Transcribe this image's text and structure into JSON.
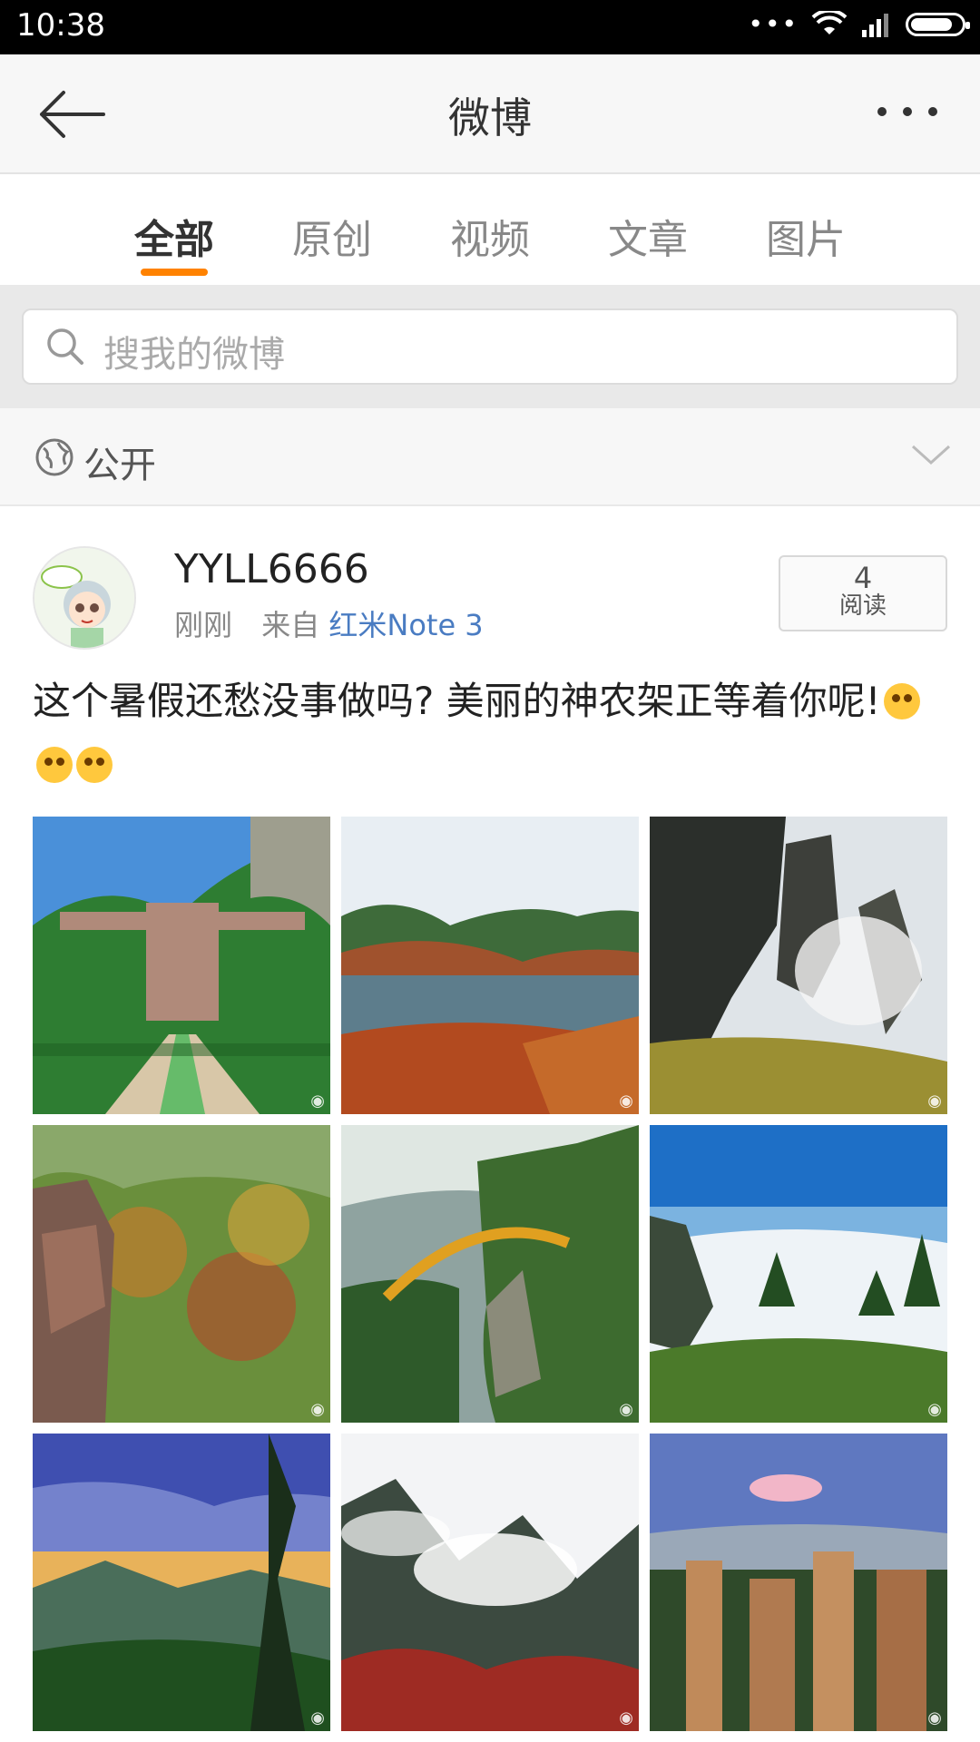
{
  "status_bar": {
    "time": "10:38",
    "dots": "•••"
  },
  "header": {
    "title": "微博"
  },
  "tabs": [
    {
      "label": "全部",
      "active": true
    },
    {
      "label": "原创",
      "active": false
    },
    {
      "label": "视频",
      "active": false
    },
    {
      "label": "文章",
      "active": false
    },
    {
      "label": "图片",
      "active": false
    }
  ],
  "search": {
    "placeholder": "搜我的微博"
  },
  "privacy": {
    "label": "公开"
  },
  "post": {
    "username": "YYLL6666",
    "time": "刚刚",
    "source_prefix": "来自",
    "device": "红米Note 3",
    "read_count": "4",
    "read_label": "阅读",
    "text": "这个暑假还愁没事做吗? 美丽的神农架正等着你呢!",
    "emoji_count": 3
  },
  "colors": {
    "accent": "#ff8200",
    "link": "#4a7cc2"
  }
}
